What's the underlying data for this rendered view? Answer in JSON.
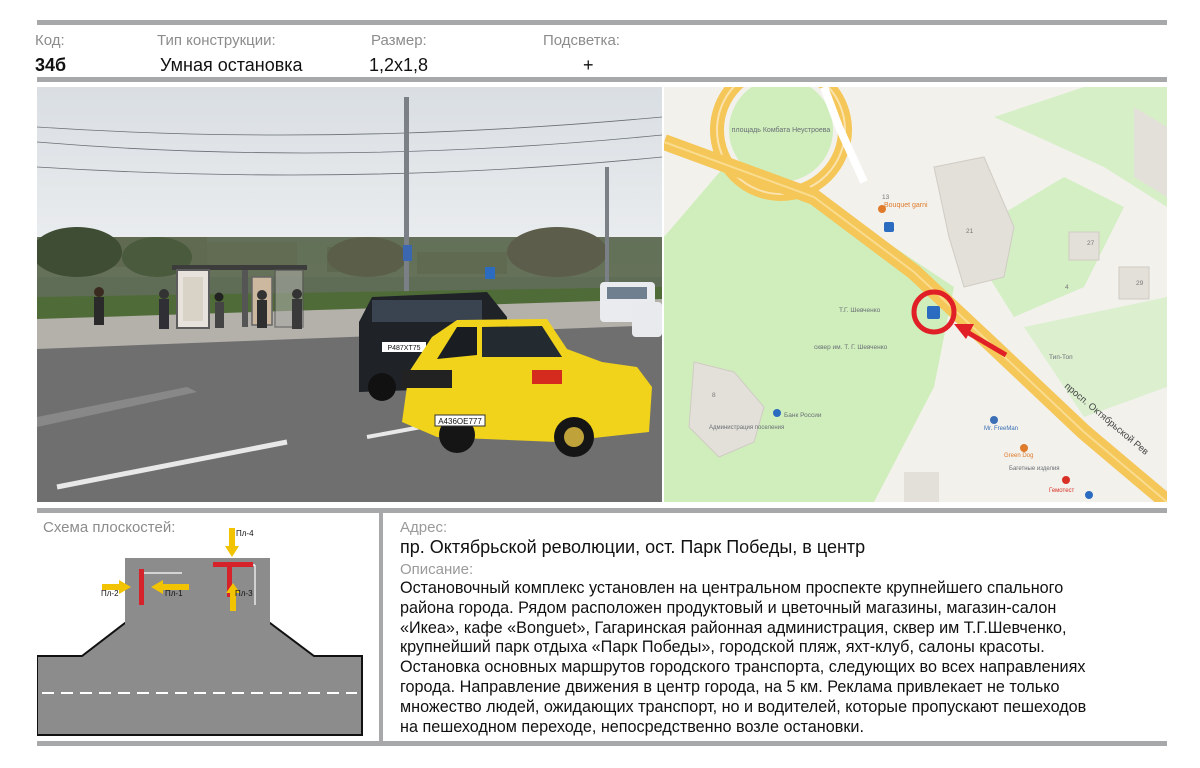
{
  "header": {
    "code_label": "Код:",
    "code_value": "34б",
    "type_label": "Тип конструкции:",
    "type_value": "Умная остановка",
    "size_label": "Размер:",
    "size_value": "1,2x1,8",
    "light_label": "Подсветка:",
    "light_value": "+"
  },
  "photo": {
    "plate_front": "А436ОЕ777",
    "plate_back": "Р487ХТ75"
  },
  "map": {
    "square_label": "площадь Комбата Неустроева",
    "street_label": "просп. Октябрьской Рев",
    "park_label": "сквер им. Т. Г. Шевченко",
    "monument_label": "Т.Г. Шевченко",
    "poi": [
      {
        "name": "Bouquet garni"
      },
      {
        "name": "Банк России"
      },
      {
        "name": "Администрация поселения"
      },
      {
        "name": "Mr. FreeMan"
      },
      {
        "name": "Green Dog"
      },
      {
        "name": "Багетные изделия"
      },
      {
        "name": "Гемотест"
      },
      {
        "name": "Тип-Топ"
      }
    ],
    "house_numbers": [
      "13",
      "21",
      "27",
      "29",
      "8",
      "4"
    ]
  },
  "scheme": {
    "title": "Схема плоскостей:",
    "planes": [
      "Пл-1",
      "Пл-2",
      "Пл-3",
      "Пл-4"
    ]
  },
  "address": {
    "label": "Адрес:",
    "value": "пр. Октябрьской революции, ост. Парк Победы, в центр"
  },
  "description": {
    "label": "Описание:",
    "lines": [
      "Остановочный комплекс установлен на центральном проспекте крупнейшего спального",
      "района города. Рядом  расположен продуктовый и цветочный магазины, магазин-салон",
      "«Икеа», кафе «Bonguet», Гагаринская районная администрация, сквер им Т.Г.Шевченко,",
      "крупнейший парк отдыха «Парк Победы», городской пляж, яхт-клуб, салоны красоты.",
      "Остановка основных маршрутов городского транспорта, следующих во всех направлениях",
      "города. Направление движения в центр города, на 5 км. Реклама привлекает не только",
      "множество людей, ожидающих транспорт, но и водителей, которые пропускают пешеходов",
      "на  пешеходном переходе,  непосредственно возле остановки."
    ]
  },
  "colors": {
    "frame_gray": "#a7a8aa",
    "plane_red": "#d6222a",
    "plane_yellow": "#f2c300",
    "road_gray": "#8c8c8c",
    "map_road": "#f5c658",
    "map_park": "#cfeebc",
    "map_marker": "#e01f26"
  }
}
